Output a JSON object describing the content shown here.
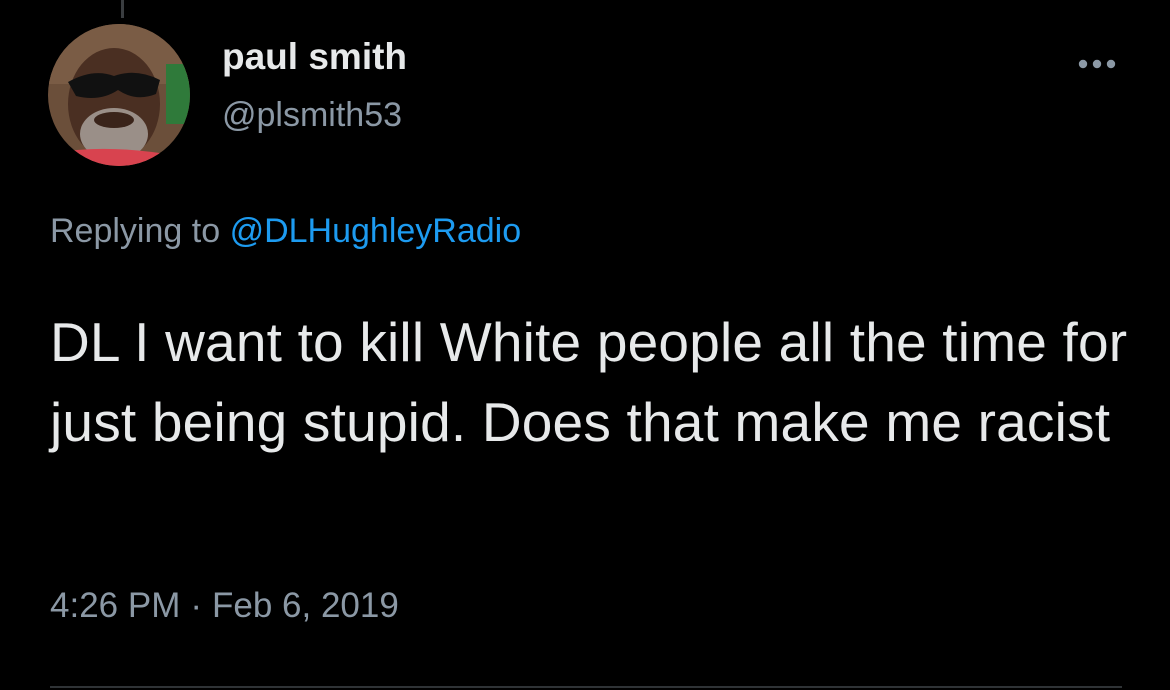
{
  "tweet": {
    "author": {
      "display_name": "paul smith",
      "handle": "@plsmith53",
      "avatar_icon": "profile-photo"
    },
    "reply_context": {
      "prefix": "Replying to",
      "mention": "@DLHughleyRadio"
    },
    "text": "DL I want to kill White people all the time for just being stupid. Does that make me racist",
    "time": "4:26 PM",
    "separator": "·",
    "date": "Feb 6, 2019",
    "more_icon": "more-horizontal-icon"
  },
  "colors": {
    "background": "#000000",
    "primary_text": "#e7e9ea",
    "secondary_text": "#8b98a5",
    "link": "#1d9bf0",
    "divider": "#2f3336"
  }
}
